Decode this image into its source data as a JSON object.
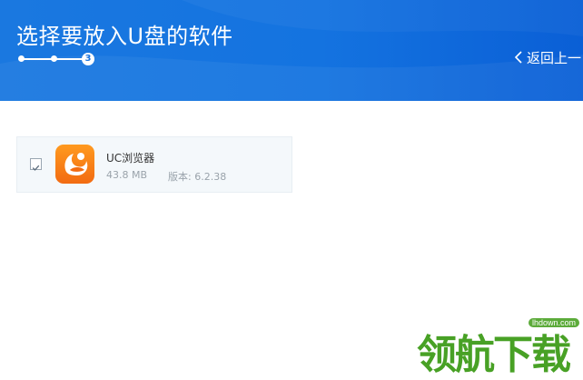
{
  "header": {
    "title": "选择要放入U盘的软件",
    "current_step": "3",
    "back_label": "返回上一"
  },
  "app": {
    "name": "UC浏览器",
    "size": "43.8 MB",
    "version": "版本: 6.2.38",
    "checked": true,
    "icon": "uc-browser-icon"
  },
  "watermark": {
    "text": "领航下载",
    "domain": "lhdown.com"
  },
  "colors": {
    "header_blue": "#1473e0",
    "icon_orange": "#f6821a",
    "watermark_green": "#48a125"
  }
}
